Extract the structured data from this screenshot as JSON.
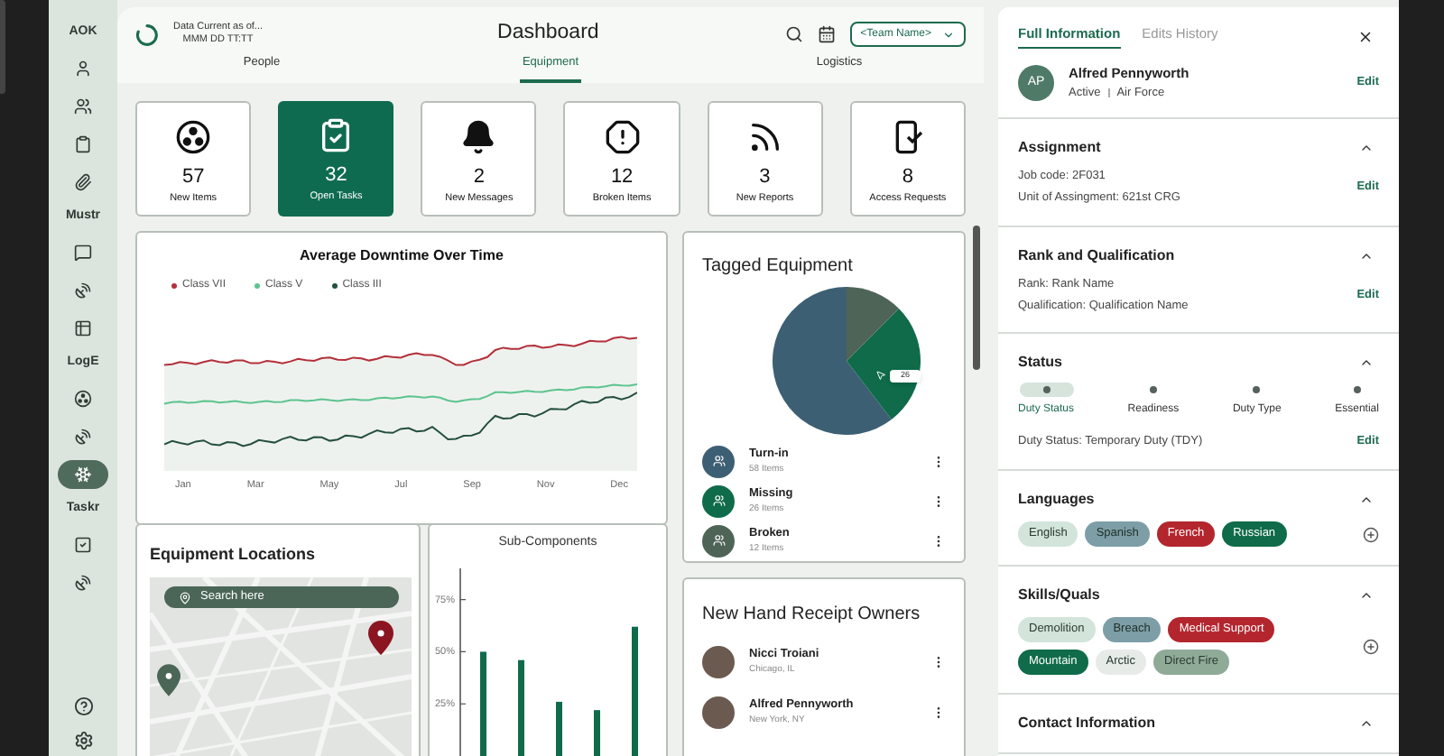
{
  "sidebar": {
    "groups": [
      {
        "label": "AOK",
        "items": [
          {
            "selected": false
          },
          {
            "selected": false
          },
          {
            "selected": false
          },
          {
            "selected": false
          }
        ]
      },
      {
        "label": "Mustr",
        "items": [
          {
            "selected": false
          },
          {
            "selected": false
          },
          {
            "selected": false
          }
        ]
      },
      {
        "label": "LogE",
        "items": [
          {
            "selected": false
          },
          {
            "selected": false
          },
          {
            "selected": true
          }
        ]
      },
      {
        "label": "Taskr",
        "items": [
          {
            "selected": false
          },
          {
            "selected": false
          }
        ]
      }
    ]
  },
  "header": {
    "status_line": "Data Current as of...",
    "timestamp": "MMM DD TT:TT",
    "title": "Dashboard",
    "team_select": "<Team Name>"
  },
  "tabs": [
    {
      "label": "People",
      "selected": false
    },
    {
      "label": "Equipment",
      "selected": true
    },
    {
      "label": "Logistics",
      "selected": false
    }
  ],
  "stats": [
    {
      "value": "57",
      "label": "New Items",
      "selected": false
    },
    {
      "value": "32",
      "label": "Open Tasks",
      "selected": true
    },
    {
      "value": "2",
      "label": "New Messages",
      "selected": false
    },
    {
      "value": "12",
      "label": "Broken Items",
      "selected": false
    },
    {
      "value": "3",
      "label": "New Reports",
      "selected": false
    },
    {
      "value": "8",
      "label": "Access Requests",
      "selected": false
    }
  ],
  "downtime_chart": {
    "title": "Average Downtime Over Time",
    "legend": [
      {
        "label": "Class VII",
        "color": "#b3303a"
      },
      {
        "label": "Class V",
        "color": "#5cc48e"
      },
      {
        "label": "Class III",
        "color": "#24503d"
      }
    ],
    "x_labels": [
      "Jan",
      "Mar",
      "May",
      "Jul",
      "Sep",
      "Nov",
      "Dec"
    ]
  },
  "tagged_equipment": {
    "title": "Tagged Equipment",
    "chart_data": {
      "type": "pie",
      "values": [
        60.4,
        27.1,
        12.5
      ]
    },
    "tooltip": "26",
    "items": [
      {
        "name": "Turn-in",
        "count": "58 Items",
        "color": "#3d5f73"
      },
      {
        "name": "Missing",
        "count": "26 Items",
        "color": "#0f6b4a"
      },
      {
        "name": "Broken",
        "count": "12 Items",
        "color": "#4e6457"
      }
    ]
  },
  "equipment_locations": {
    "title": "Equipment Locations",
    "search": {
      "placeholder": "Search here"
    }
  },
  "sub_components": {
    "title": "Sub-Components",
    "axis_labels": [
      "75%",
      "50%",
      "25%"
    ]
  },
  "hand_receipt_owners": {
    "title": "New Hand Receipt Owners",
    "people": [
      {
        "name": "Nicci Troiani",
        "location": "Chicago, IL"
      },
      {
        "name": "Alfred Pennyworth",
        "location": "New York, NY"
      }
    ]
  },
  "details_panel": {
    "tabs": [
      {
        "label": "Full Information",
        "selected": true
      },
      {
        "label": "Edits History",
        "selected": false
      }
    ],
    "profile": {
      "initials": "AP",
      "name": "Alfred Pennyworth",
      "status": "Active",
      "branch": "Air Force",
      "action": "Edit"
    },
    "sections": [
      {
        "kind": "details",
        "title": "Assignment",
        "expanded": true,
        "lines": [
          "Job code: 2F031",
          "Unit of Assingment: 621st CRG"
        ],
        "action": "Edit"
      },
      {
        "kind": "details",
        "title": "Rank and Qualification",
        "expanded": true,
        "lines": [
          "Rank: Rank Name",
          "Qualification: Qualification Name"
        ],
        "action": "Edit"
      },
      {
        "kind": "status",
        "title": "Status",
        "expanded": true,
        "steps": [
          {
            "label": "Duty Status",
            "selected": true
          },
          {
            "label": "Readiness",
            "selected": false
          },
          {
            "label": "Duty Type",
            "selected": false
          },
          {
            "label": "Essential",
            "selected": false
          }
        ],
        "line": "Duty Status: Temporary Duty (TDY)",
        "action": "Edit"
      },
      {
        "kind": "tags",
        "title": "Languages",
        "expanded": true,
        "tags": [
          {
            "label": "English",
            "color": "#d3e5da"
          },
          {
            "label": "Spanish",
            "color": "#7d9ea6"
          },
          {
            "label": "French",
            "color": "#b3262e"
          },
          {
            "label": "Russian",
            "color": "#0f6b4a"
          }
        ]
      },
      {
        "kind": "tags",
        "title": "Skills/Quals",
        "expanded": true,
        "tags": [
          {
            "label": "Demolition",
            "color": "#d3e5da"
          },
          {
            "label": "Breach",
            "color": "#7d9ea6"
          },
          {
            "label": "Medical Support",
            "color": "#b3262e"
          },
          {
            "label": "Mountain",
            "color": "#0f6b4a"
          },
          {
            "label": "Arctic",
            "color": "#e6ebe8"
          },
          {
            "label": "Direct Fire",
            "color": "#8fab98"
          }
        ]
      },
      {
        "kind": "details",
        "title": "Contact Information",
        "expanded": true
      }
    ]
  }
}
